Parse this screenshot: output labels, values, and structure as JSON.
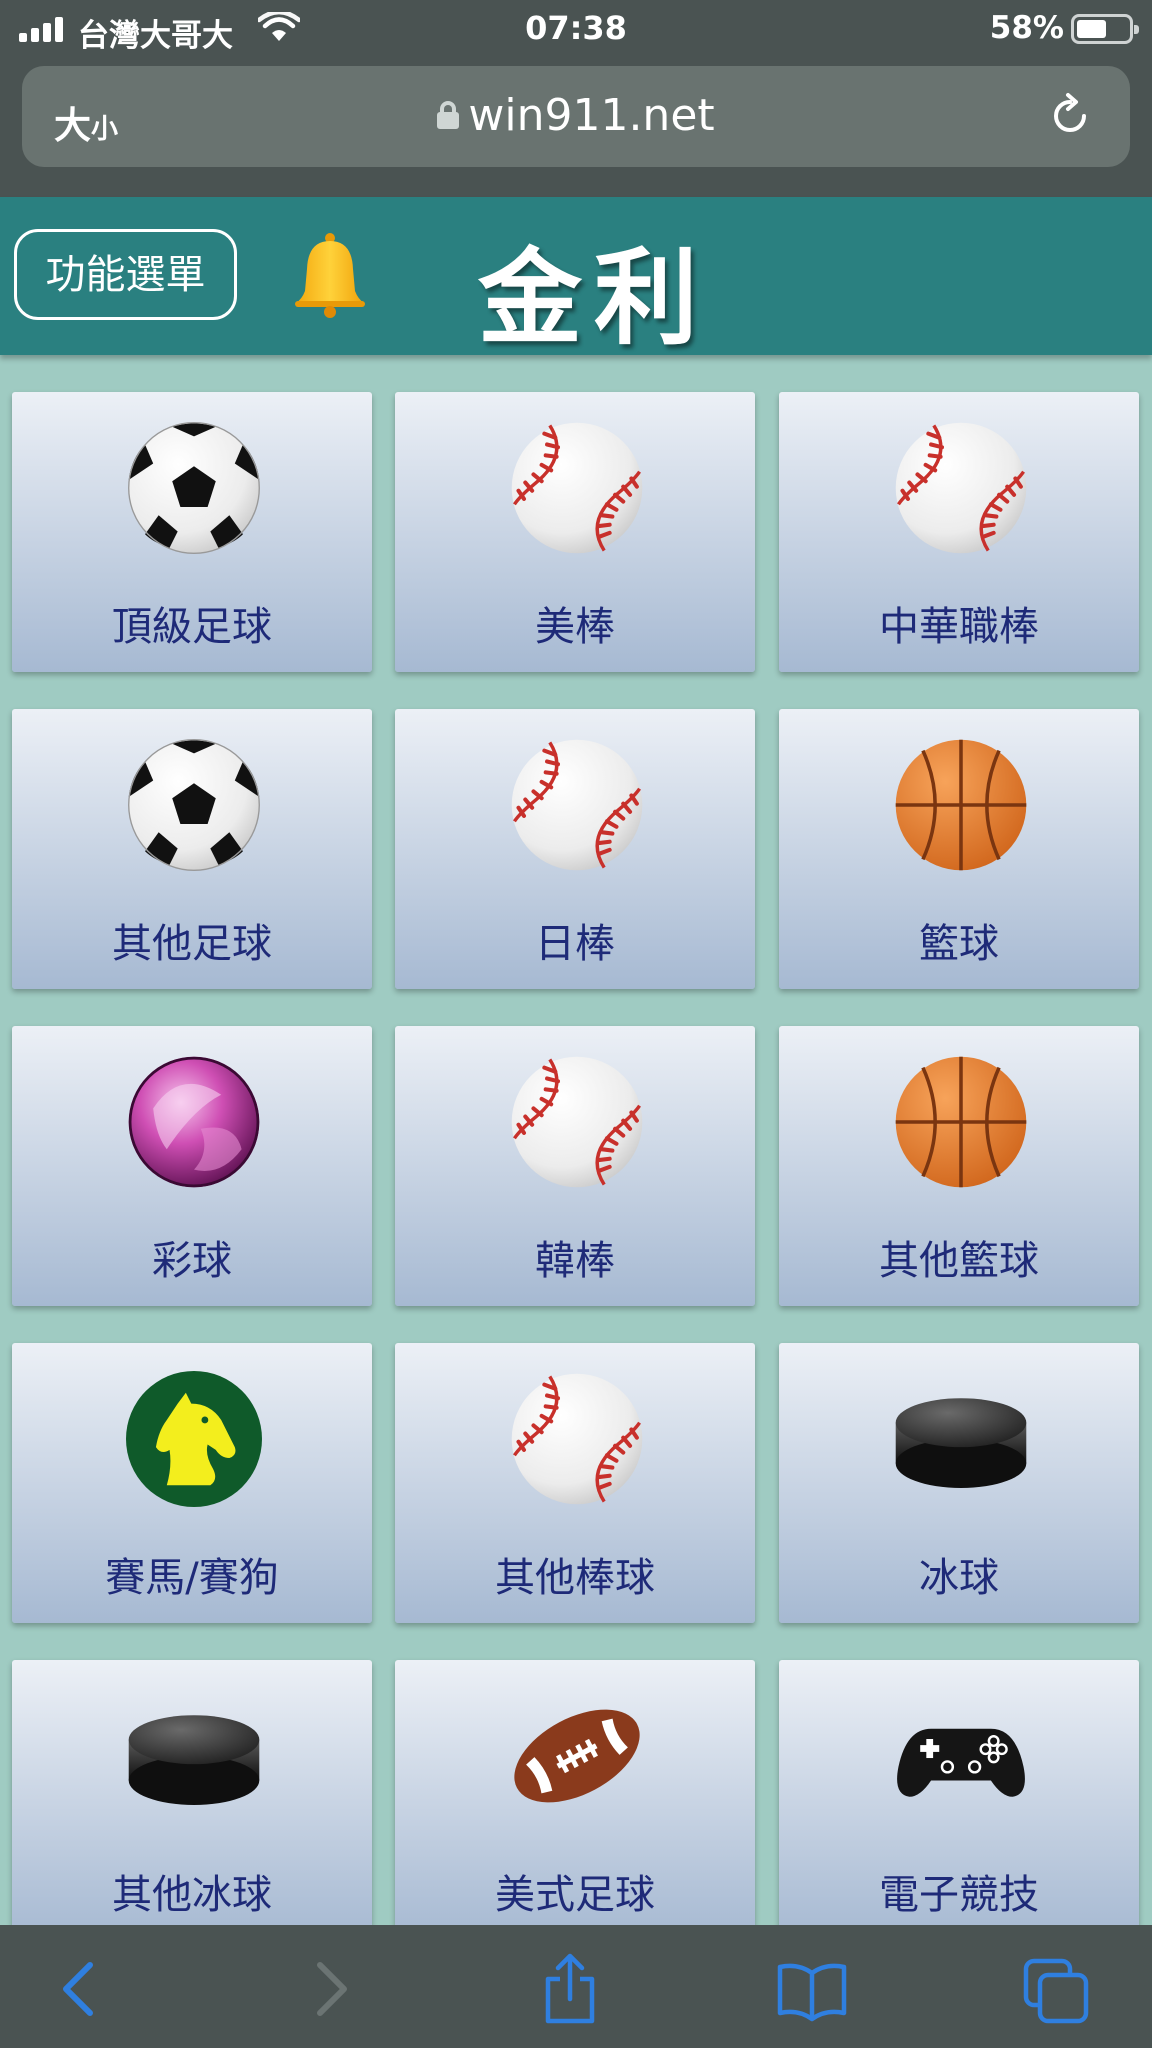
{
  "status_bar": {
    "carrier": "台灣大哥大",
    "time": "07:38",
    "battery_percent": "58%",
    "battery_level": 0.58,
    "signal_bars": 4,
    "icons": [
      "signal-icon",
      "wifi-icon",
      "battery-icon"
    ]
  },
  "browser": {
    "text_size_label_large": "大",
    "text_size_label_small": "小",
    "url": "win911.net",
    "icons": [
      "lock-icon",
      "reload-icon"
    ],
    "toolbar_icons": [
      "back-icon",
      "forward-icon",
      "share-icon",
      "bookmarks-icon",
      "tabs-icon"
    ],
    "accent_color": "#2f7fe0"
  },
  "header": {
    "menu_label": "功能選單",
    "brand": "金利",
    "background_color": "#2a8080",
    "icons": [
      "bell-icon"
    ]
  },
  "sports": [
    {
      "label": "頂級足球",
      "icon": "soccer-ball-icon"
    },
    {
      "label": "美棒",
      "icon": "baseball-icon"
    },
    {
      "label": "中華職棒",
      "icon": "baseball-icon"
    },
    {
      "label": "其他足球",
      "icon": "soccer-ball-icon"
    },
    {
      "label": "日棒",
      "icon": "baseball-icon"
    },
    {
      "label": "籃球",
      "icon": "basketball-icon"
    },
    {
      "label": "彩球",
      "icon": "lottery-ball-icon"
    },
    {
      "label": "韓棒",
      "icon": "baseball-icon"
    },
    {
      "label": "其他籃球",
      "icon": "basketball-icon"
    },
    {
      "label": "賽馬/賽狗",
      "icon": "horse-head-icon"
    },
    {
      "label": "其他棒球",
      "icon": "baseball-icon"
    },
    {
      "label": "冰球",
      "icon": "hockey-puck-icon"
    },
    {
      "label": "其他冰球",
      "icon": "hockey-puck-icon"
    },
    {
      "label": "美式足球",
      "icon": "american-football-icon"
    },
    {
      "label": "電子競技",
      "icon": "gamepad-icon"
    }
  ]
}
